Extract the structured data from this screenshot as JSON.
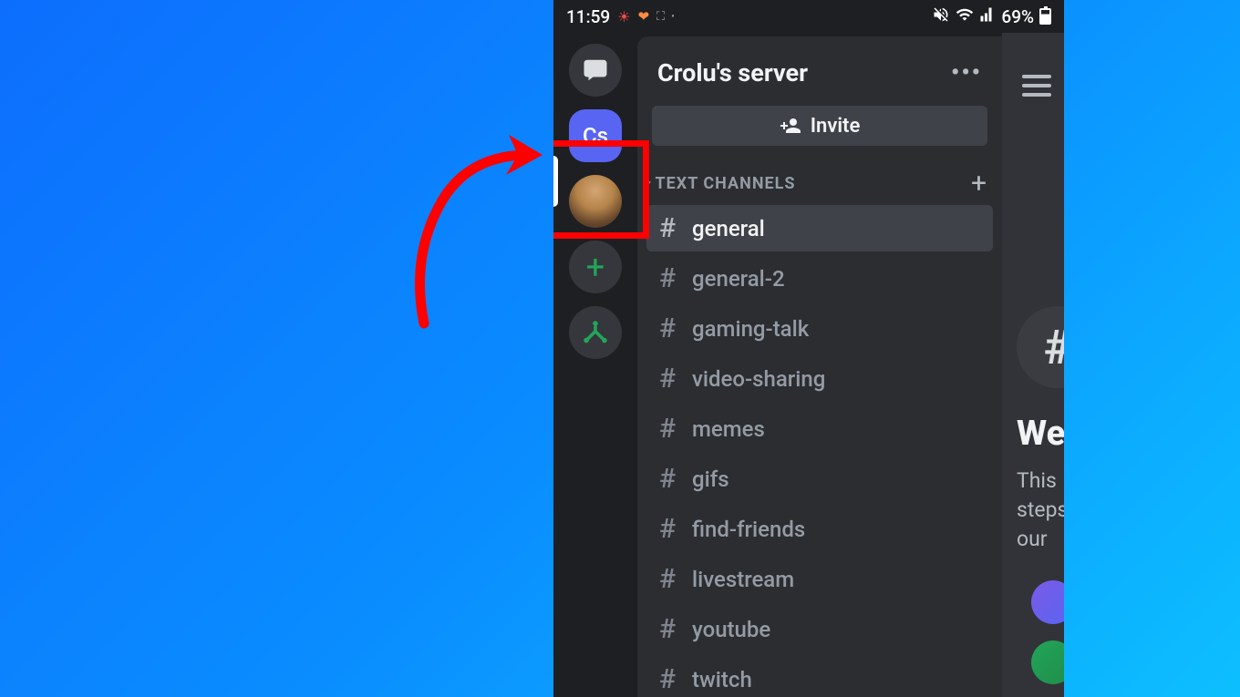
{
  "status_bar": {
    "time": "11:59",
    "battery_text": "69%"
  },
  "server": {
    "title": "Crolu's server",
    "icon_initials": "Cs",
    "invite_label": "Invite",
    "category_label": "TEXT CHANNELS",
    "channels": [
      {
        "name": "general",
        "active": true
      },
      {
        "name": "general-2",
        "active": false
      },
      {
        "name": "gaming-talk",
        "active": false
      },
      {
        "name": "video-sharing",
        "active": false
      },
      {
        "name": "memes",
        "active": false
      },
      {
        "name": "gifs",
        "active": false
      },
      {
        "name": "find-friends",
        "active": false
      },
      {
        "name": "livestream",
        "active": false
      },
      {
        "name": "youtube",
        "active": false
      },
      {
        "name": "twitch",
        "active": false
      }
    ]
  },
  "content_peek": {
    "welcome_title": "We",
    "welcome_line1": "This",
    "welcome_line2": "steps",
    "welcome_line3": "our"
  }
}
